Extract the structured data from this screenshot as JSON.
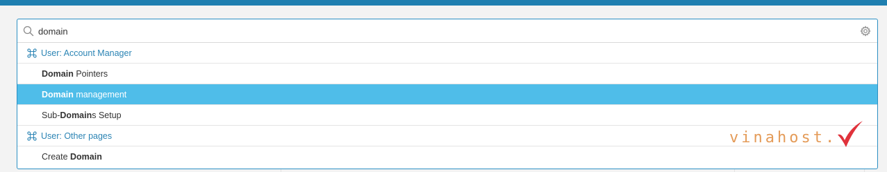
{
  "search": {
    "value": "domain",
    "placeholder": ""
  },
  "results": {
    "groups": [
      {
        "label": "User: Account Manager",
        "icon": "command-icon",
        "items": [
          {
            "prefix": "",
            "match": "Domain",
            "suffix": " Pointers",
            "selected": false
          },
          {
            "prefix": "",
            "match": "Domain",
            "suffix": " management",
            "selected": true
          },
          {
            "prefix": "Sub-",
            "match": "Domain",
            "suffix": "s Setup",
            "selected": false
          }
        ]
      },
      {
        "label": "User: Other pages",
        "icon": "command-icon",
        "items": [
          {
            "prefix": "Create ",
            "match": "Domain",
            "suffix": "",
            "selected": false
          }
        ]
      }
    ]
  },
  "watermark": {
    "text": "vinahost."
  },
  "colors": {
    "accent": "#2b84b4",
    "selected_bg": "#4fbde9",
    "topbar": "#1f7fb0",
    "watermark": "#e08a3c",
    "watermark_check": "#e0323b"
  }
}
